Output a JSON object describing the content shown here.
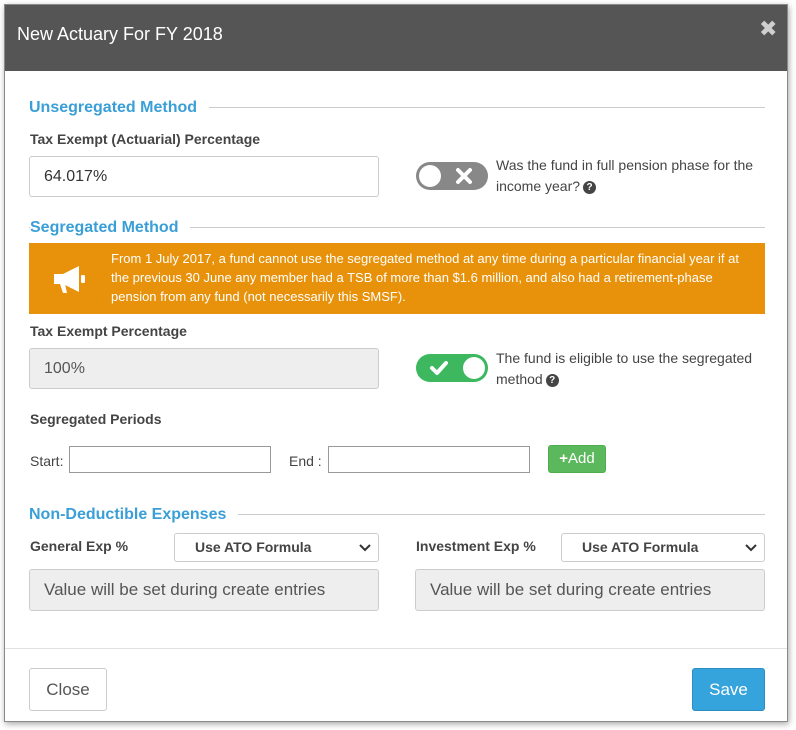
{
  "modal": {
    "title": "New Actuary For FY 2018",
    "close_symbol": "✖"
  },
  "unsegregated": {
    "section_title": "Unsegregated Method",
    "field_label": "Tax Exempt (Actuarial) Percentage",
    "field_value": "64.017%",
    "toggle_state": "off",
    "toggle_text": "Was the fund in full pension phase for the income year?"
  },
  "segregated": {
    "section_title": "Segregated Method",
    "notice_icon": "megaphone-icon",
    "notice_text": "From 1 July 2017, a fund cannot use the segregated method at any time during a particular financial year if at the previous 30 June any member had a TSB of more than $1.6 million, and also had a retirement-phase pension from any fund (not necessarily this SMSF).",
    "field_label": "Tax Exempt Percentage",
    "field_value": "100%",
    "toggle_state": "on",
    "toggle_text": "The fund is eligible to use the segregated method",
    "periods_label": "Segregated Periods",
    "start_label": "Start:",
    "start_value": "",
    "end_label": "End :",
    "end_value": "",
    "add_label": "Add"
  },
  "non_deductible": {
    "section_title": "Non-Deductible Expenses",
    "general_label": "General Exp %",
    "general_select": "Use ATO Formula",
    "general_value": "Value will be set during create entries",
    "investment_label": "Investment Exp %",
    "investment_select": "Use ATO Formula",
    "investment_value": "Value will be set during create entries"
  },
  "footer": {
    "close_label": "Close",
    "save_label": "Save"
  },
  "colors": {
    "header_bg": "#555555",
    "accent_blue": "#3a9fd6",
    "notice_orange": "#e7920a",
    "toggle_on": "#3db85f",
    "toggle_off": "#888888",
    "add_green": "#5cb85c",
    "save_blue": "#35a3dc"
  }
}
